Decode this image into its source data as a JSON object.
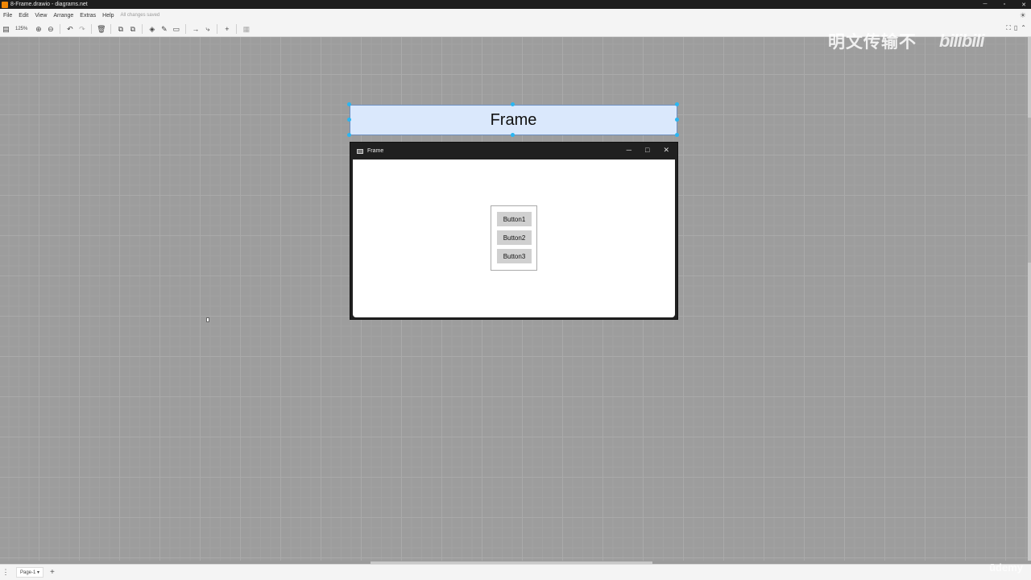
{
  "window": {
    "title": "8-Frame.drawio - diagrams.net"
  },
  "menubar": {
    "items": [
      "File",
      "Edit",
      "View",
      "Arrange",
      "Extras",
      "Help"
    ],
    "status": "All changes saved"
  },
  "toolbar": {
    "zoom": "125%"
  },
  "watermark": {
    "text": "明文传输不",
    "logo": "bilibili"
  },
  "diagram": {
    "frame_label": "Frame",
    "window_title": "Frame",
    "buttons": [
      "Button1",
      "Button2",
      "Button3"
    ]
  },
  "bottombar": {
    "page_tab": "Page-1"
  },
  "udemy": "ūdemy",
  "colors": {
    "selection_handle": "#29b6f2",
    "label_fill": "#dae8fc",
    "label_border": "#6c8ebf"
  }
}
